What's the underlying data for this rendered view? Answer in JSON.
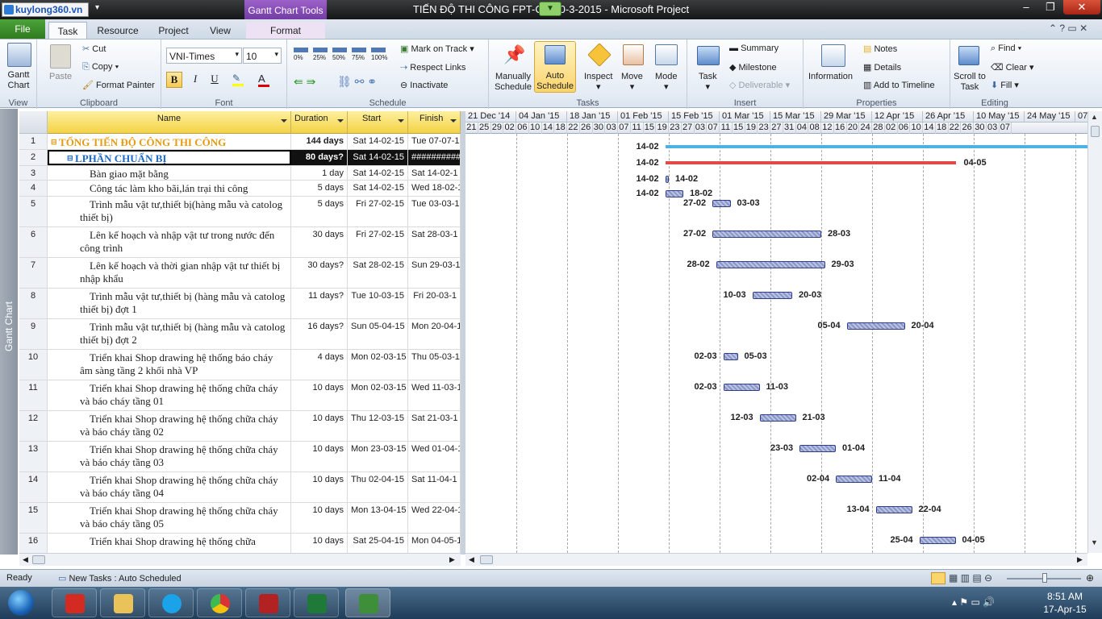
{
  "window": {
    "title": "TIẾN ĐỘ THI CÔNG FPT-CO...0-3-2015  -  Microsoft Project",
    "logo": "kuylong360.vn",
    "contextual_tab": "Gantt Chart Tools"
  },
  "tabs": [
    "File",
    "Task",
    "Resource",
    "Project",
    "View",
    "Format"
  ],
  "ribbon": {
    "view": {
      "label": "View",
      "gantt": "Gantt Chart"
    },
    "clipboard": {
      "label": "Clipboard",
      "paste": "Paste",
      "cut": "Cut",
      "copy": "Copy",
      "format_painter": "Format Painter"
    },
    "font": {
      "label": "Font",
      "family": "VNI-Times",
      "size": "10"
    },
    "schedule": {
      "label": "Schedule",
      "pcts": [
        "0%",
        "25%",
        "50%",
        "75%",
        "100%"
      ],
      "mark_on_track": "Mark on Track",
      "respect_links": "Respect Links",
      "inactivate": "Inactivate"
    },
    "tasks": {
      "label": "Tasks",
      "manual": "Manually Schedule",
      "auto": "Auto Schedule",
      "inspect": "Inspect",
      "move": "Move",
      "mode": "Mode"
    },
    "insert": {
      "label": "Insert",
      "task": "Task",
      "summary": "Summary",
      "milestone": "Milestone",
      "deliverable": "Deliverable"
    },
    "properties": {
      "label": "Properties",
      "information": "Information",
      "notes": "Notes",
      "details": "Details",
      "add_to_timeline": "Add to Timeline"
    },
    "editing": {
      "label": "Editing",
      "scroll": "Scroll to Task",
      "find": "Find",
      "clear": "Clear",
      "fill": "Fill"
    }
  },
  "view_bar_label": "Gantt Chart",
  "columns": {
    "name": "Name",
    "duration": "Duration",
    "start": "Start",
    "finish": "Finish"
  },
  "tasks": [
    {
      "id": "1",
      "name": "TỔNG TIẾN ĐỘ CÔNG THI CÔNG",
      "duration": "144 days",
      "start": "Sat 14-02-15",
      "finish": "Tue 07-07-1",
      "level": "summary1"
    },
    {
      "id": "2",
      "name": "LPHẦN CHUẨN BỊ",
      "duration": "80 days?",
      "start": "Sat 14-02-15",
      "finish": "###########",
      "level": "summary2"
    },
    {
      "id": "3",
      "name": "Bàn giao mặt bằng",
      "duration": "1 day",
      "start": "Sat 14-02-15",
      "finish": "Sat 14-02-1",
      "level": "task"
    },
    {
      "id": "4",
      "name": "Công tác làm kho bãi,lán trại thi công",
      "duration": "5 days",
      "start": "Sat 14-02-15",
      "finish": "Wed 18-02-1",
      "level": "task"
    },
    {
      "id": "5",
      "name": "Trình mẫu vật tư,thiết bị(hàng mẫu và catolog thiết bị)",
      "duration": "5 days",
      "start": "Fri 27-02-15",
      "finish": "Tue 03-03-1",
      "level": "task"
    },
    {
      "id": "6",
      "name": "Lên kế hoạch và nhập vật tư trong nước đến công trình",
      "duration": "30 days",
      "start": "Fri 27-02-15",
      "finish": "Sat 28-03-1",
      "level": "task"
    },
    {
      "id": "7",
      "name": "Lên kế hoạch và thời gian nhập vật tư thiết bị nhập khẩu",
      "duration": "30 days?",
      "start": "Sat 28-02-15",
      "finish": "Sun 29-03-1",
      "level": "task"
    },
    {
      "id": "8",
      "name": "Trình mẫu vật tư,thiết bị (hàng mẫu và catolog thiết bị) đợt 1",
      "duration": "11 days?",
      "start": "Tue 10-03-15",
      "finish": "Fri 20-03-1",
      "level": "task"
    },
    {
      "id": "9",
      "name": "Trình mẫu vật tư,thiết bị (hàng mẫu và catolog thiết bị) đợt 2",
      "duration": "16 days?",
      "start": "Sun 05-04-15",
      "finish": "Mon 20-04-1",
      "level": "task"
    },
    {
      "id": "10",
      "name": "Triển khai Shop drawing hệ thống báo cháy âm sàng tầng 2 khối nhà VP",
      "duration": "4 days",
      "start": "Mon 02-03-15",
      "finish": "Thu 05-03-1",
      "level": "task"
    },
    {
      "id": "11",
      "name": "Triển khai Shop drawing hệ thống chữa cháy và báo cháy tầng 01",
      "duration": "10 days",
      "start": "Mon 02-03-15",
      "finish": "Wed 11-03-1",
      "level": "task"
    },
    {
      "id": "12",
      "name": "Triển khai Shop drawing hệ thống chữa cháy và báo cháy tầng 02",
      "duration": "10 days",
      "start": "Thu 12-03-15",
      "finish": "Sat 21-03-1",
      "level": "task"
    },
    {
      "id": "13",
      "name": "Triển khai Shop drawing hệ thống chữa cháy và báo cháy tầng 03",
      "duration": "10 days",
      "start": "Mon 23-03-15",
      "finish": "Wed 01-04-1",
      "level": "task"
    },
    {
      "id": "14",
      "name": "Triển khai Shop drawing hệ thống chữa cháy và báo cháy tầng 04",
      "duration": "10 days",
      "start": "Thu 02-04-15",
      "finish": "Sat 11-04-1",
      "level": "task"
    },
    {
      "id": "15",
      "name": "Triển khai Shop drawing hệ thống chữa cháy và báo cháy tầng 05",
      "duration": "10 days",
      "start": "Mon 13-04-15",
      "finish": "Wed 22-04-1",
      "level": "task"
    },
    {
      "id": "16",
      "name": "Triển khai Shop drawing hệ thống chữa",
      "duration": "10 days",
      "start": "Sat 25-04-15",
      "finish": "Mon 04-05-1",
      "level": "task"
    }
  ],
  "timescale": {
    "weeks": [
      "21 Dec '14",
      "04 Jan '15",
      "18 Jan '15",
      "01 Feb '15",
      "15 Feb '15",
      "01 Mar '15",
      "15 Mar '15",
      "29 Mar '15",
      "12 Apr '15",
      "26 Apr '15",
      "10 May '15",
      "24 May '15",
      "07"
    ],
    "days": [
      "21",
      "25",
      "29",
      "02",
      "06",
      "10",
      "14",
      "18",
      "22",
      "26",
      "30",
      "03",
      "07",
      "11",
      "15",
      "19",
      "23",
      "27",
      "03",
      "07",
      "11",
      "15",
      "19",
      "23",
      "27",
      "31",
      "04",
      "08",
      "12",
      "16",
      "20",
      "24",
      "28",
      "02",
      "06",
      "10",
      "14",
      "18",
      "22",
      "26",
      "30",
      "03",
      "07"
    ]
  },
  "gantt_labels": [
    {
      "start": "14-02",
      "finish": ""
    },
    {
      "start": "14-02",
      "finish": "04-05"
    },
    {
      "start": "14-02",
      "finish": "14-02"
    },
    {
      "start": "14-02",
      "finish": "18-02"
    },
    {
      "start": "27-02",
      "finish": "03-03"
    },
    {
      "start": "27-02",
      "finish": "28-03"
    },
    {
      "start": "28-02",
      "finish": "29-03"
    },
    {
      "start": "10-03",
      "finish": "20-03"
    },
    {
      "start": "05-04",
      "finish": "20-04"
    },
    {
      "start": "02-03",
      "finish": "05-03"
    },
    {
      "start": "02-03",
      "finish": "11-03"
    },
    {
      "start": "12-03",
      "finish": "21-03"
    },
    {
      "start": "23-03",
      "finish": "01-04"
    },
    {
      "start": "02-04",
      "finish": "11-04"
    },
    {
      "start": "13-04",
      "finish": "22-04"
    },
    {
      "start": "25-04",
      "finish": "04-05"
    }
  ],
  "status": {
    "ready": "Ready",
    "new_tasks": "New Tasks : Auto Scheduled"
  },
  "clock": {
    "time": "8:51 AM",
    "date": "17-Apr-15"
  },
  "colors": {
    "header_yellow": "#f4d245",
    "summary_orange": "#e79a10",
    "summary_blue": "#1a68c8",
    "bar_border": "#2e3c8c",
    "summary_bar": "#4cb2e5",
    "critical_bar": "#e04a4a"
  }
}
